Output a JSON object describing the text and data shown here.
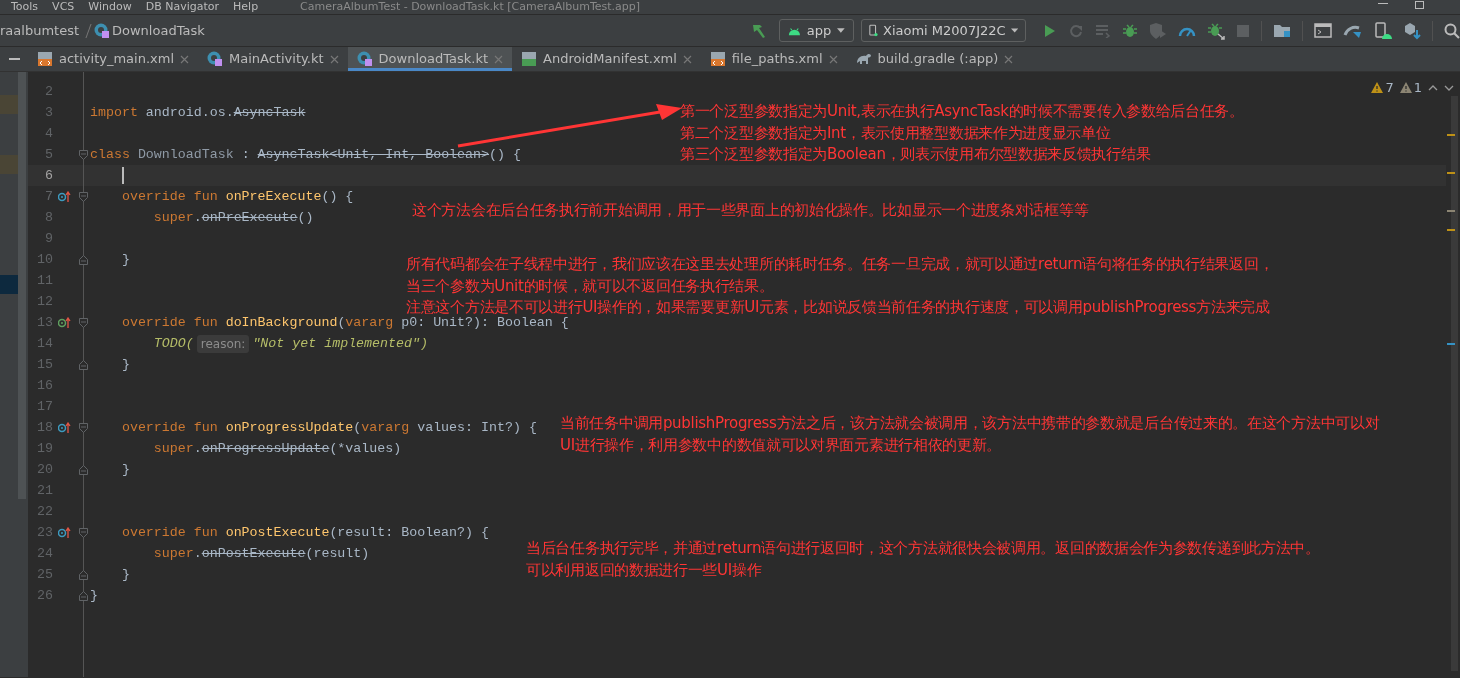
{
  "menu": [
    "Tools",
    "VCS",
    "Window",
    "DB Navigator",
    "Help"
  ],
  "window": {
    "title": "CameraAlbumTest - DownloadTask.kt [CameraAlbumTest.app]"
  },
  "breadcrumb": [
    "raalbumtest",
    "DownloadTask"
  ],
  "toolbar": {
    "run_config": "app",
    "device": "Xiaomi M2007J22C"
  },
  "tabs": [
    {
      "label": "activity_main.xml",
      "kind": "layout",
      "selected": false
    },
    {
      "label": "MainActivity.kt",
      "kind": "kotlin",
      "selected": false
    },
    {
      "label": "DownloadTask.kt",
      "kind": "kotlin",
      "selected": true
    },
    {
      "label": "AndroidManifest.xml",
      "kind": "manifest",
      "selected": false
    },
    {
      "label": "file_paths.xml",
      "kind": "layout",
      "selected": false
    },
    {
      "label": "build.gradle (:app)",
      "kind": "gradle",
      "selected": false
    }
  ],
  "inspections": {
    "warnings": "7",
    "weak_warnings": "1"
  },
  "code": {
    "lines": [
      {
        "number": "2",
        "current": false,
        "overrides": false,
        "implements": false,
        "fold_start": false,
        "fold_end": false
      },
      {
        "number": "3",
        "current": false,
        "overrides": false,
        "implements": false,
        "fold_start": false,
        "fold_end": false,
        "tokens": [
          {
            "kind": "keyword",
            "text": "import "
          },
          {
            "kind": "plain",
            "text": "android.os."
          },
          {
            "kind": "deprecated",
            "text": "AsyncTask"
          }
        ]
      },
      {
        "number": "4",
        "current": false,
        "overrides": false,
        "implements": false,
        "fold_start": false,
        "fold_end": false
      },
      {
        "number": "5",
        "current": false,
        "overrides": false,
        "implements": false,
        "fold_start": true,
        "fold_end": false,
        "tokens": [
          {
            "kind": "keyword",
            "text": "class "
          },
          {
            "kind": "class",
            "text": "DownloadTask"
          },
          {
            "kind": "plain",
            "text": " : "
          },
          {
            "kind": "deprecated",
            "text": "AsyncTask<Unit, Int, Boolean>"
          },
          {
            "kind": "plain",
            "text": "() {"
          }
        ]
      },
      {
        "number": "6",
        "current": true,
        "overrides": false,
        "implements": false,
        "fold_start": false,
        "fold_end": false
      },
      {
        "number": "7",
        "current": false,
        "overrides": true,
        "implements": false,
        "fold_start": true,
        "fold_end": false,
        "tokens": [
          {
            "kind": "keyword",
            "text": "    override fun "
          },
          {
            "kind": "function",
            "text": "onPreExecute"
          },
          {
            "kind": "plain",
            "text": "() {"
          }
        ]
      },
      {
        "number": "8",
        "current": false,
        "overrides": false,
        "implements": false,
        "fold_start": false,
        "fold_end": false,
        "tokens": [
          {
            "kind": "keyword",
            "text": "        super"
          },
          {
            "kind": "plain",
            "text": "."
          },
          {
            "kind": "deprecated",
            "text": "onPreExecute"
          },
          {
            "kind": "plain",
            "text": "()"
          }
        ]
      },
      {
        "number": "9",
        "current": false,
        "overrides": false,
        "implements": false,
        "fold_start": false,
        "fold_end": false
      },
      {
        "number": "10",
        "current": false,
        "overrides": false,
        "implements": false,
        "fold_start": false,
        "fold_end": true,
        "tokens": [
          {
            "kind": "plain",
            "text": "    }"
          }
        ]
      },
      {
        "number": "11",
        "current": false,
        "overrides": false,
        "implements": false,
        "fold_start": false,
        "fold_end": false
      },
      {
        "number": "12",
        "current": false,
        "overrides": false,
        "implements": false,
        "fold_start": false,
        "fold_end": false
      },
      {
        "number": "13",
        "current": false,
        "overrides": false,
        "implements": true,
        "fold_start": true,
        "fold_end": false,
        "tokens": [
          {
            "kind": "keyword",
            "text": "    override fun "
          },
          {
            "kind": "function",
            "text": "doInBackground"
          },
          {
            "kind": "plain",
            "text": "("
          },
          {
            "kind": "keyword",
            "text": "vararg "
          },
          {
            "kind": "plain",
            "text": "p0: Unit?): Boolean {"
          }
        ]
      },
      {
        "number": "14",
        "current": false,
        "overrides": false,
        "implements": false,
        "fold_start": false,
        "fold_end": false,
        "tokens": [
          {
            "kind": "todo",
            "text": "        TODO("
          },
          {
            "kind": "hint",
            "text": "reason:"
          },
          {
            "kind": "string",
            "text": "\"Not yet implemented\""
          },
          {
            "kind": "todo",
            "text": ")"
          }
        ]
      },
      {
        "number": "15",
        "current": false,
        "overrides": false,
        "implements": false,
        "fold_start": false,
        "fold_end": true,
        "tokens": [
          {
            "kind": "plain",
            "text": "    }"
          }
        ]
      },
      {
        "number": "16",
        "current": false,
        "overrides": false,
        "implements": false,
        "fold_start": false,
        "fold_end": false
      },
      {
        "number": "17",
        "current": false,
        "overrides": false,
        "implements": false,
        "fold_start": false,
        "fold_end": false
      },
      {
        "number": "18",
        "current": false,
        "overrides": true,
        "implements": false,
        "fold_start": true,
        "fold_end": false,
        "tokens": [
          {
            "kind": "keyword",
            "text": "    override fun "
          },
          {
            "kind": "function",
            "text": "onProgressUpdate"
          },
          {
            "kind": "plain",
            "text": "("
          },
          {
            "kind": "keyword",
            "text": "vararg "
          },
          {
            "kind": "plain",
            "text": "values: Int?) {"
          }
        ]
      },
      {
        "number": "19",
        "current": false,
        "overrides": false,
        "implements": false,
        "fold_start": false,
        "fold_end": false,
        "tokens": [
          {
            "kind": "keyword",
            "text": "        super"
          },
          {
            "kind": "plain",
            "text": "."
          },
          {
            "kind": "deprecated",
            "text": "onProgressUpdate"
          },
          {
            "kind": "plain",
            "text": "(*values)"
          }
        ]
      },
      {
        "number": "20",
        "current": false,
        "overrides": false,
        "implements": false,
        "fold_start": false,
        "fold_end": true,
        "tokens": [
          {
            "kind": "plain",
            "text": "    }"
          }
        ]
      },
      {
        "number": "21",
        "current": false,
        "overrides": false,
        "implements": false,
        "fold_start": false,
        "fold_end": false
      },
      {
        "number": "22",
        "current": false,
        "overrides": false,
        "implements": false,
        "fold_start": false,
        "fold_end": false
      },
      {
        "number": "23",
        "current": false,
        "overrides": true,
        "implements": false,
        "fold_start": true,
        "fold_end": false,
        "tokens": [
          {
            "kind": "keyword",
            "text": "    override fun "
          },
          {
            "kind": "function",
            "text": "onPostExecute"
          },
          {
            "kind": "plain",
            "text": "(result: Boolean?) {"
          }
        ]
      },
      {
        "number": "24",
        "current": false,
        "overrides": false,
        "implements": false,
        "fold_start": false,
        "fold_end": false,
        "tokens": [
          {
            "kind": "keyword",
            "text": "        super"
          },
          {
            "kind": "plain",
            "text": "."
          },
          {
            "kind": "deprecated",
            "text": "onPostExecute"
          },
          {
            "kind": "plain",
            "text": "(result)"
          }
        ]
      },
      {
        "number": "25",
        "current": false,
        "overrides": false,
        "implements": false,
        "fold_start": false,
        "fold_end": true,
        "tokens": [
          {
            "kind": "plain",
            "text": "    }"
          }
        ]
      },
      {
        "number": "26",
        "current": false,
        "overrides": false,
        "implements": false,
        "fold_start": false,
        "fold_end": true,
        "tokens": [
          {
            "kind": "plain",
            "text": "}"
          }
        ]
      }
    ]
  },
  "annotations": [
    {
      "lines": [
        "第一个泛型参数指定为Unit,表示在执行AsyncTask的时候不需要传入参数给后台任务。",
        "第二个泛型参数指定为Int，表示使用整型数据来作为进度显示单位",
        "第三个泛型参数指定为Boolean，则表示使用布尔型数据来反馈执行结果"
      ]
    },
    {
      "lines": [
        "这个方法会在后台任务执行前开始调用，用于一些界面上的初始化操作。比如显示一个进度条对话框等等"
      ]
    },
    {
      "lines": [
        "所有代码都会在子线程中进行，我们应该在这里去处理所的耗时任务。任务一旦完成，就可以通过return语句将任务的执行结果返回，",
        "当三个参数为Unit的时候，就可以不返回任务执行结果。",
        "注意这个方法是不可以进行UI操作的，如果需要更新UI元素，比如说反馈当前任务的执行速度，可以调用publishProgress方法来完成"
      ]
    },
    {
      "lines": [
        "当前任务中调用publishProgress方法之后，该方法就会被调用，该方法中携带的参数就是后台传过来的。在这个方法中可以对",
        "UI进行操作，利用参数中的数值就可以对界面元素进行相依的更新。"
      ]
    },
    {
      "lines": [
        "当后台任务执行完毕，并通过return语句进行返回时，这个方法就很快会被调用。返回的数据会作为参数传递到此方法中。",
        "可以利用返回的数据进行一些UI操作"
      ]
    }
  ]
}
